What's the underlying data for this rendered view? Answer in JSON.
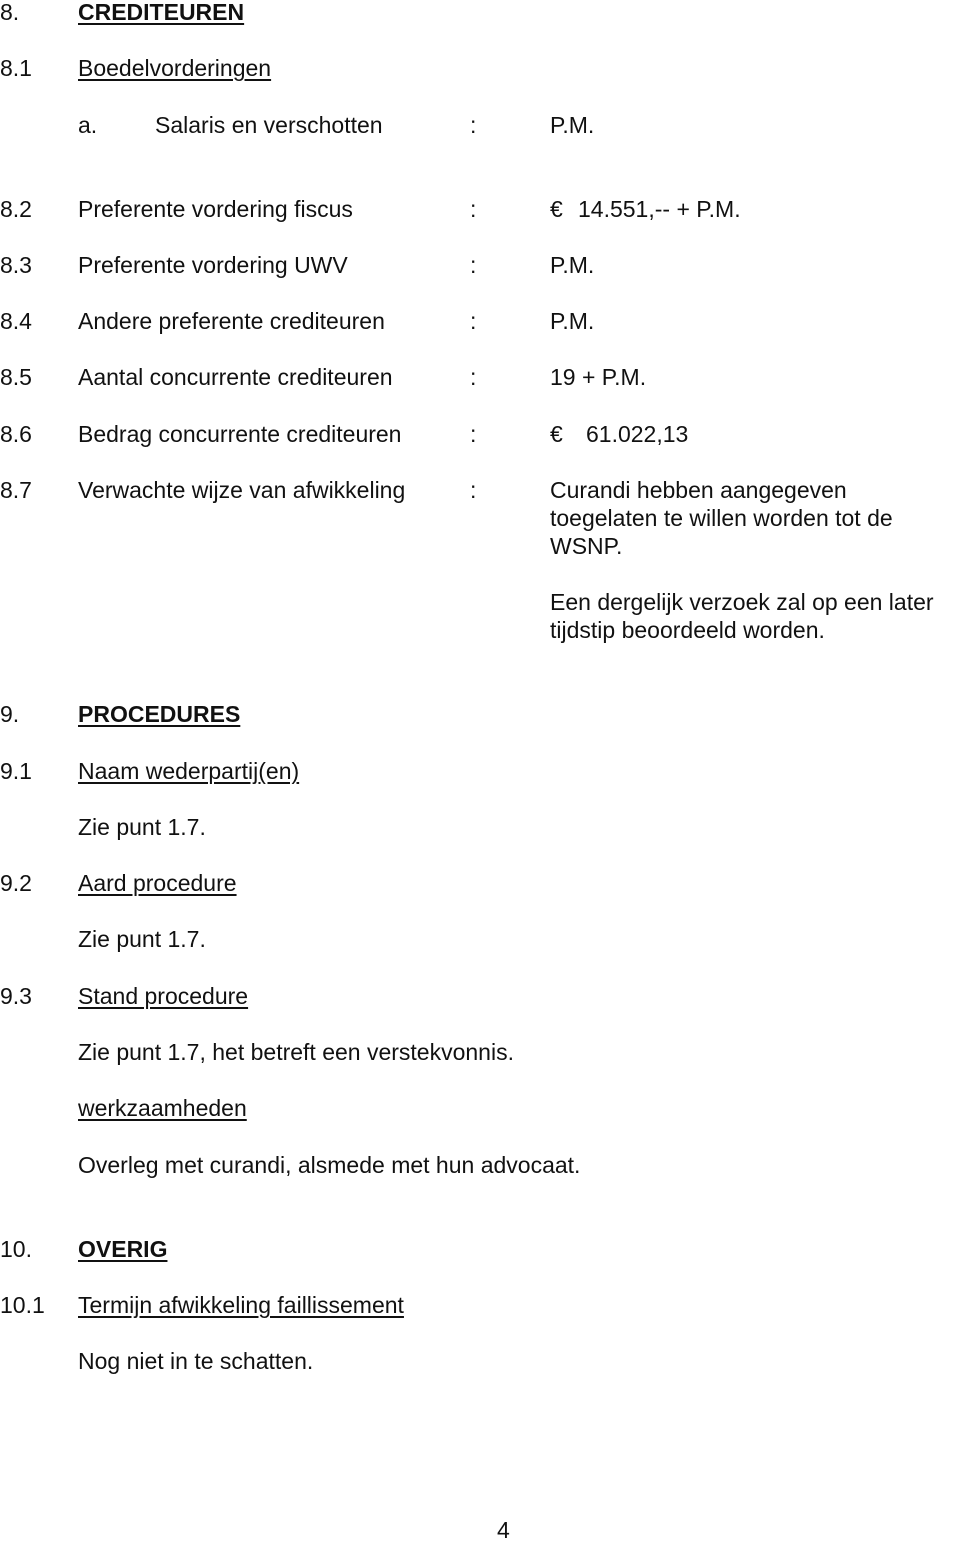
{
  "sections": {
    "s8": {
      "number": "8.",
      "title": "CREDITEUREN",
      "s8_1": {
        "number": "8.1",
        "title": "Boedelvorderingen",
        "item_a": {
          "marker": "a.",
          "label": "Salaris en verschotten",
          "colon": ":",
          "value": "P.M."
        }
      },
      "s8_2": {
        "number": "8.2",
        "label": "Preferente vordering fiscus",
        "colon": ":",
        "currency": "€",
        "value": "14.551,-- + P.M."
      },
      "s8_3": {
        "number": "8.3",
        "label": "Preferente vordering UWV",
        "colon": ":",
        "value": "P.M."
      },
      "s8_4": {
        "number": "8.4",
        "label": "Andere preferente crediteuren",
        "colon": ":",
        "value": "P.M."
      },
      "s8_5": {
        "number": "8.5",
        "label": "Aantal concurrente crediteuren",
        "colon": ":",
        "value": "19 + P.M."
      },
      "s8_6": {
        "number": "8.6",
        "label": "Bedrag concurrente crediteuren",
        "colon": ":",
        "currency": "€",
        "value": "61.022,13"
      },
      "s8_7": {
        "number": "8.7",
        "label": "Verwachte wijze van afwikkeling",
        "colon": ":",
        "lines": [
          "Curandi hebben aangegeven",
          "toegelaten te willen worden tot de",
          "WSNP.",
          "Een dergelijk verzoek zal op een later",
          "tijdstip beoordeeld worden."
        ]
      }
    },
    "s9": {
      "number": "9.",
      "title": "PROCEDURES",
      "s9_1": {
        "number": "9.1",
        "title": "Naam wederpartij(en)",
        "text": "Zie punt 1.7."
      },
      "s9_2": {
        "number": "9.2",
        "title": "Aard procedure",
        "text": "Zie punt 1.7."
      },
      "s9_3": {
        "number": "9.3",
        "title": "Stand procedure",
        "text": "Zie punt 1.7, het betreft een verstekvonnis.",
        "werk_title": "werkzaamheden",
        "werk_text": "Overleg met curandi, alsmede met hun advocaat."
      }
    },
    "s10": {
      "number": "10.",
      "title": "OVERIG",
      "s10_1": {
        "number": "10.1",
        "title": "Termijn afwikkeling faillissement",
        "text": "Nog niet in te schatten."
      }
    }
  },
  "footer": {
    "page_number": "4"
  }
}
